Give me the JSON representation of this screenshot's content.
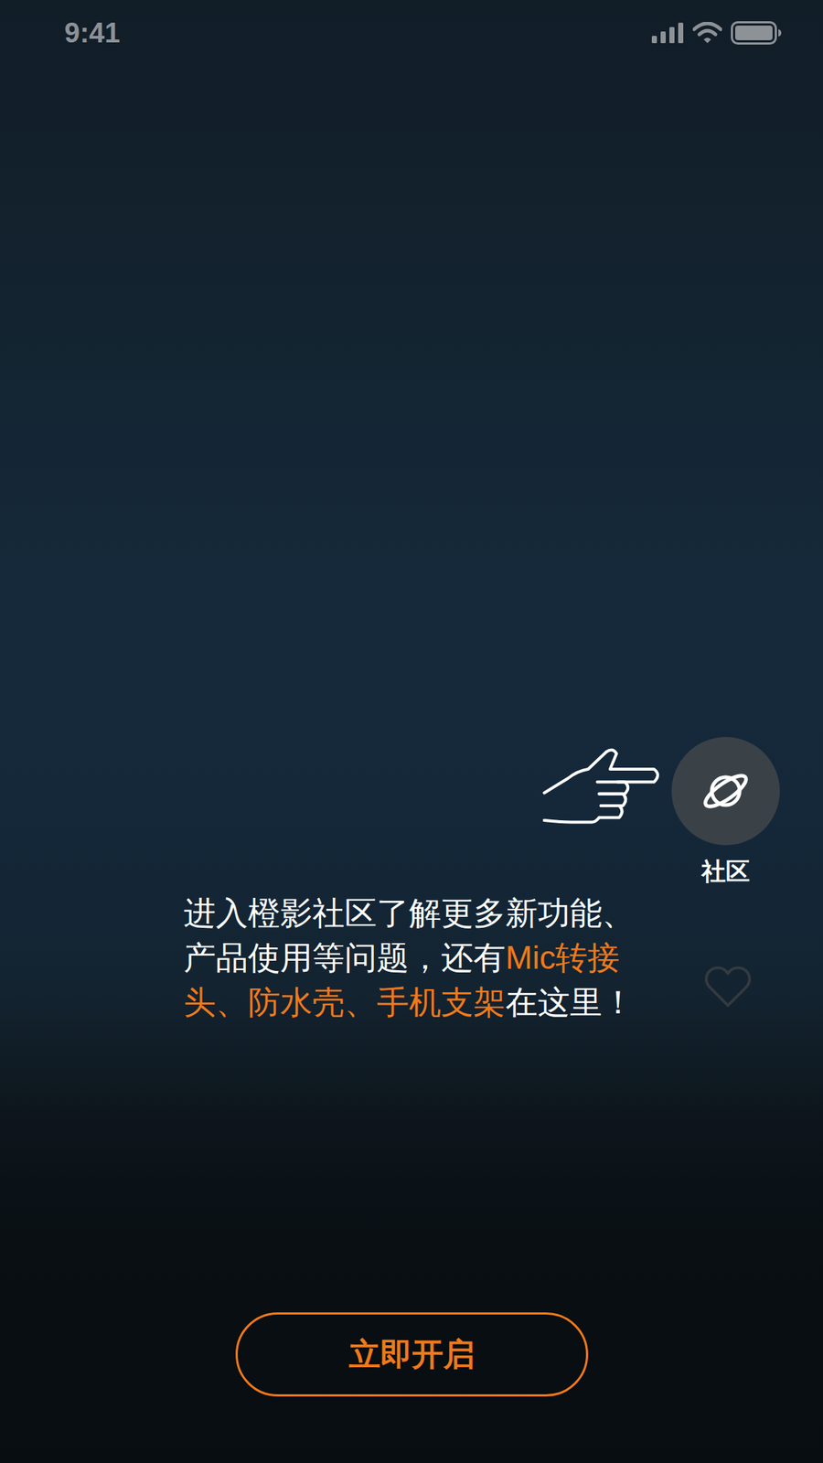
{
  "status_bar": {
    "time": "9:41"
  },
  "community_button": {
    "label": "社区"
  },
  "like_button": {
    "liked": false
  },
  "tip": {
    "segments": [
      {
        "text": "进入橙影社区了解更多新功能、产品使用等问题，还有",
        "highlight": false
      },
      {
        "text": "Mic转接头、防水壳、手机支架",
        "highlight": true
      },
      {
        "text": "在这里！",
        "highlight": false
      }
    ]
  },
  "primary_button": {
    "label": "立即开启"
  }
}
